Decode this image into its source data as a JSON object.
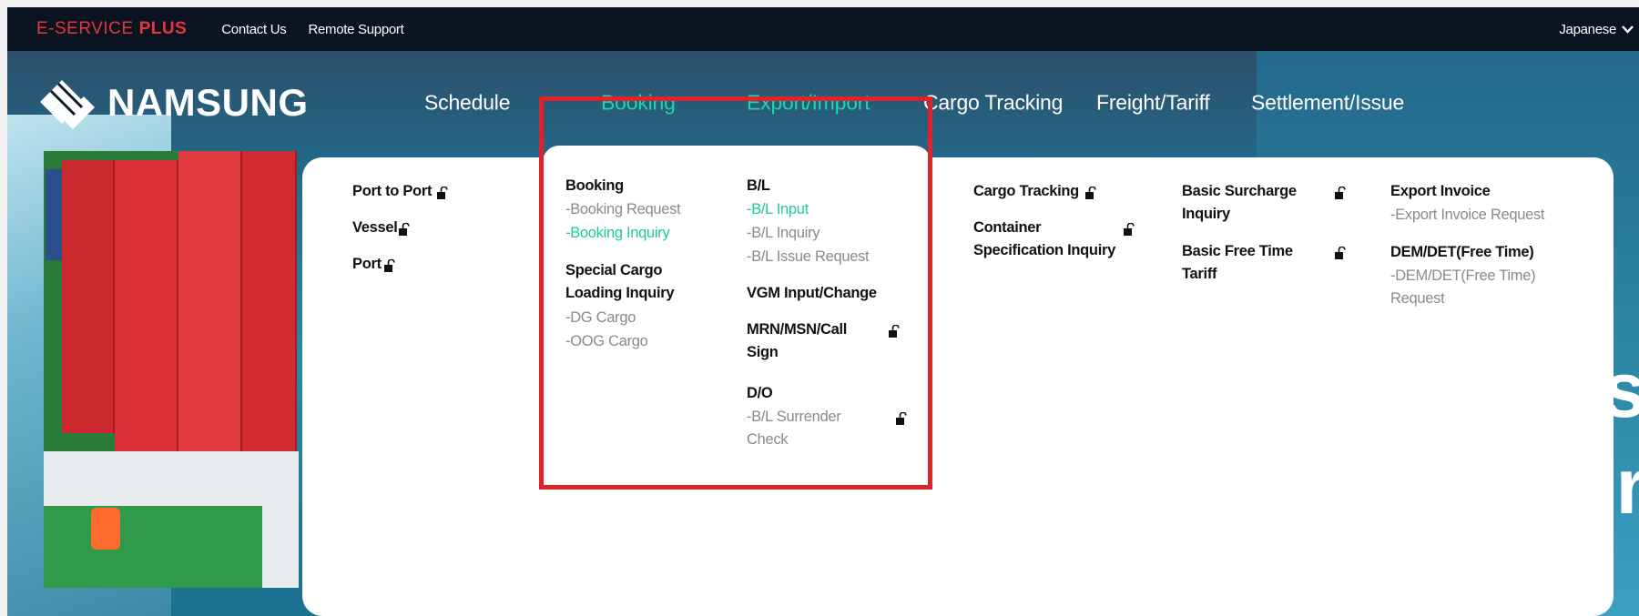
{
  "topbar": {
    "brand_a": "E-SERVICE",
    "brand_b": "PLUS",
    "links": [
      "Contact Us",
      "Remote Support"
    ],
    "language": "Japanese"
  },
  "logo": {
    "text": "NAMSUNG"
  },
  "nav": [
    "Schedule",
    "Booking",
    "Export/Import",
    "Cargo Tracking",
    "Freight/Tariff",
    "Settlement/Issue"
  ],
  "menu": {
    "schedule": [
      "Port to Port",
      "Vessel",
      "Port"
    ],
    "booking": {
      "booking_head": "Booking",
      "booking_request": "-Booking Request",
      "booking_inquiry": "-Booking Inquiry",
      "special_cargo_l1": "Special Cargo",
      "special_cargo_l2": "Loading Inquiry",
      "dg_cargo": "-DG Cargo",
      "oog_cargo": "-OOG Cargo"
    },
    "export_import": {
      "bl_head": "B/L",
      "bl_input": "-B/L Input",
      "bl_inquiry": "-B/L Inquiry",
      "bl_issue": "-B/L Issue Request",
      "vgm": "VGM Input/Change",
      "mrn_l1": "MRN/MSN/Call",
      "mrn_l2": "Sign",
      "do_head": "D/O",
      "surrender_l1": "-B/L Surrender",
      "surrender_l2": "Check"
    },
    "cargo_tracking": {
      "cargo_tracking": "Cargo Tracking",
      "container_l1": "Container",
      "container_l2": "Specification Inquiry"
    },
    "freight": {
      "surcharge_l1": "Basic Surcharge",
      "surcharge_l2": "Inquiry",
      "freetime_l1": "Basic Free Time",
      "freetime_l2": "Tariff"
    },
    "settlement": {
      "export_invoice": "Export Invoice",
      "export_invoice_req": "-Export Invoice Request",
      "demdet": "DEM/DET(Free Time)",
      "demdet_req_l1": "-DEM/DET(Free Time)",
      "demdet_req_l2": "Request"
    }
  },
  "hero_text": [
    "cs",
    "er"
  ],
  "colors": {
    "accent": "#1fd6a6",
    "brand_red": "#e8343a",
    "highlight_red": "#e0222a",
    "topbar": "#0a1420"
  },
  "icons": [
    "lock-open-icon",
    "chevron-down-icon"
  ]
}
